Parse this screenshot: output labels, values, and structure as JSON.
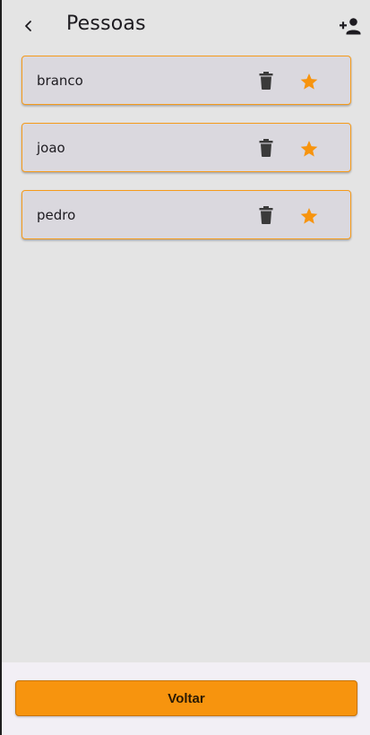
{
  "appbar": {
    "back_icon": "chevron-left-icon",
    "title": "Pessoas",
    "add_icon": "person-add-icon"
  },
  "people": [
    {
      "name": "branco",
      "trash_icon": "trash-icon",
      "star_icon": "star-icon"
    },
    {
      "name": "joao",
      "trash_icon": "trash-icon",
      "star_icon": "star-icon"
    },
    {
      "name": "pedro",
      "trash_icon": "trash-icon",
      "star_icon": "star-icon"
    }
  ],
  "footer": {
    "voltar_label": "Voltar"
  },
  "colors": {
    "accent": "#f7940e",
    "card_border": "#f59b1b",
    "card_bg": "#dad8de",
    "background": "#e4e4e4",
    "icon_dark": "#3a3a3a"
  }
}
